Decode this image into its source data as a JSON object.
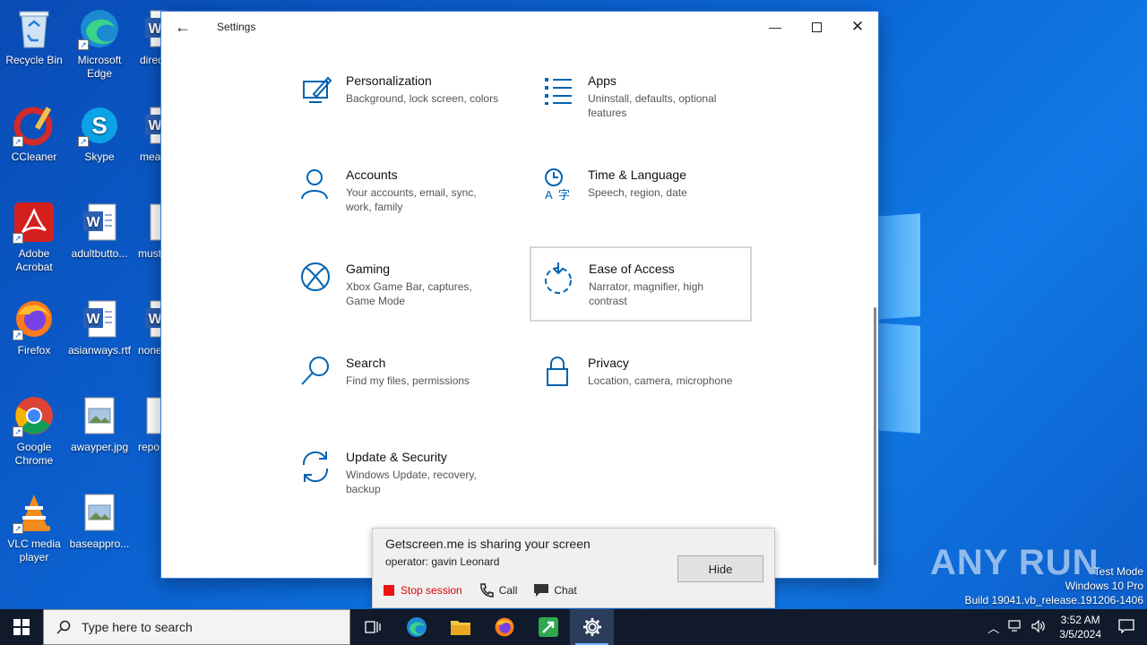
{
  "desktop": {
    "icons": [
      {
        "label": "Recycle Bin"
      },
      {
        "label": "Microsoft Edge"
      },
      {
        "label": "direct"
      },
      {
        "label": "CCleaner"
      },
      {
        "label": "Skype"
      },
      {
        "label": "mean"
      },
      {
        "label": "Adobe Acrobat"
      },
      {
        "label": "adultbutto..."
      },
      {
        "label": "must"
      },
      {
        "label": "Firefox"
      },
      {
        "label": "asianways.rtf"
      },
      {
        "label": "none"
      },
      {
        "label": "Google Chrome"
      },
      {
        "label": "awayper.jpg"
      },
      {
        "label": "repo"
      },
      {
        "label": "VLC media player"
      },
      {
        "label": "baseappro..."
      }
    ],
    "watermark": "ANY RUN",
    "test_mode": {
      "line1": "Test Mode",
      "line2": "Windows 10 Pro",
      "line3": "Build 19041.vb_release.191206-1406"
    }
  },
  "settings": {
    "title": "Settings",
    "tiles": [
      {
        "title": "Personalization",
        "desc": "Background, lock screen, colors",
        "icon": "personalization-icon"
      },
      {
        "title": "Apps",
        "desc": "Uninstall, defaults, optional features",
        "icon": "apps-icon"
      },
      {
        "title": "Accounts",
        "desc": "Your accounts, email, sync, work, family",
        "icon": "accounts-icon"
      },
      {
        "title": "Time & Language",
        "desc": "Speech, region, date",
        "icon": "time-language-icon"
      },
      {
        "title": "Gaming",
        "desc": "Xbox Game Bar, captures, Game Mode",
        "icon": "xbox-icon"
      },
      {
        "title": "Ease of Access",
        "desc": "Narrator, magnifier, high contrast",
        "icon": "ease-of-access-icon"
      },
      {
        "title": "Search",
        "desc": "Find my files, permissions",
        "icon": "search-icon"
      },
      {
        "title": "Privacy",
        "desc": "Location, camera, microphone",
        "icon": "lock-icon"
      },
      {
        "title": "Update & Security",
        "desc": "Windows Update, recovery, backup",
        "icon": "update-icon"
      }
    ]
  },
  "getscreen": {
    "title": "Getscreen.me is sharing your screen",
    "operator": "operator: gavin Leonard",
    "hide": "Hide",
    "stop": "Stop session",
    "call": "Call",
    "chat": "Chat"
  },
  "taskbar": {
    "search_placeholder": "Type here to search",
    "time": "3:52 AM",
    "date": "3/5/2024"
  },
  "colors": {
    "accent": "#0063b1",
    "taskbar": "#101a2b"
  }
}
